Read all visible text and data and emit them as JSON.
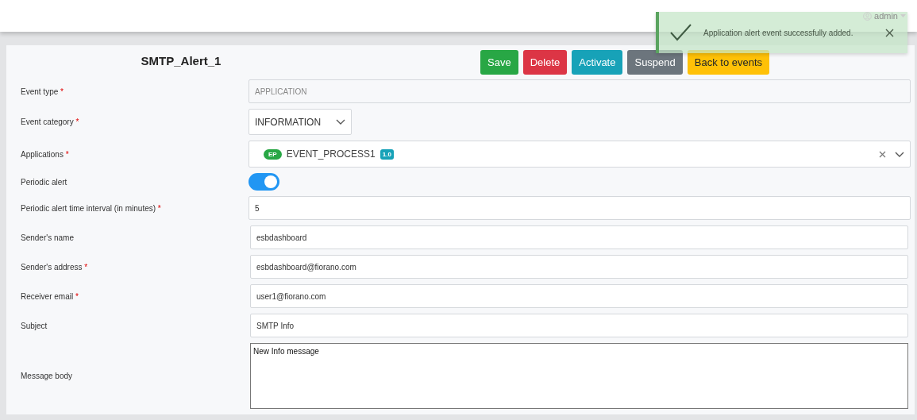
{
  "header": {
    "user": "admin"
  },
  "toast": {
    "message": "Application alert event successfully added."
  },
  "form": {
    "title": "SMTP_Alert_1",
    "actions": [
      {
        "label": "Save",
        "kind": "success"
      },
      {
        "label": "Delete",
        "kind": "danger"
      },
      {
        "label": "Activate",
        "kind": "info"
      },
      {
        "label": "Suspend",
        "kind": "secondary"
      },
      {
        "label": "Back to events",
        "kind": "warning"
      }
    ],
    "fields": [
      {
        "label": "Event type",
        "marker": "*",
        "kind": "text",
        "value": "APPLICATION",
        "disabled": true
      },
      {
        "label": "Event category",
        "marker": "*",
        "kind": "select",
        "value": "INFORMATION"
      },
      {
        "label": "Applications",
        "marker": "*",
        "kind": "multiselect",
        "chips": [
          {
            "badge": "EP",
            "name": "EVENT_PROCESS1",
            "version": "1.0"
          }
        ]
      },
      {
        "label": "Periodic alert",
        "kind": "toggle",
        "on": true
      },
      {
        "label": "Periodic alert time interval (in minutes)",
        "marker": "*",
        "kind": "text",
        "value": "5",
        "disabled": false
      },
      {
        "label": "Sender's name",
        "kind": "text",
        "value": "esbdashboard",
        "disabled": false
      },
      {
        "label": "Sender's address",
        "marker": "*",
        "kind": "text",
        "value": "esbdashboard@fiorano.com",
        "disabled": false
      },
      {
        "label": "Receiver email",
        "marker": "*",
        "kind": "text",
        "value": "user1@fiorano.com",
        "disabled": false
      },
      {
        "label": "Subject",
        "kind": "text",
        "value": "SMTP Info",
        "disabled": false
      },
      {
        "label": "Message body",
        "kind": "textarea",
        "value": "New Info message"
      }
    ]
  }
}
